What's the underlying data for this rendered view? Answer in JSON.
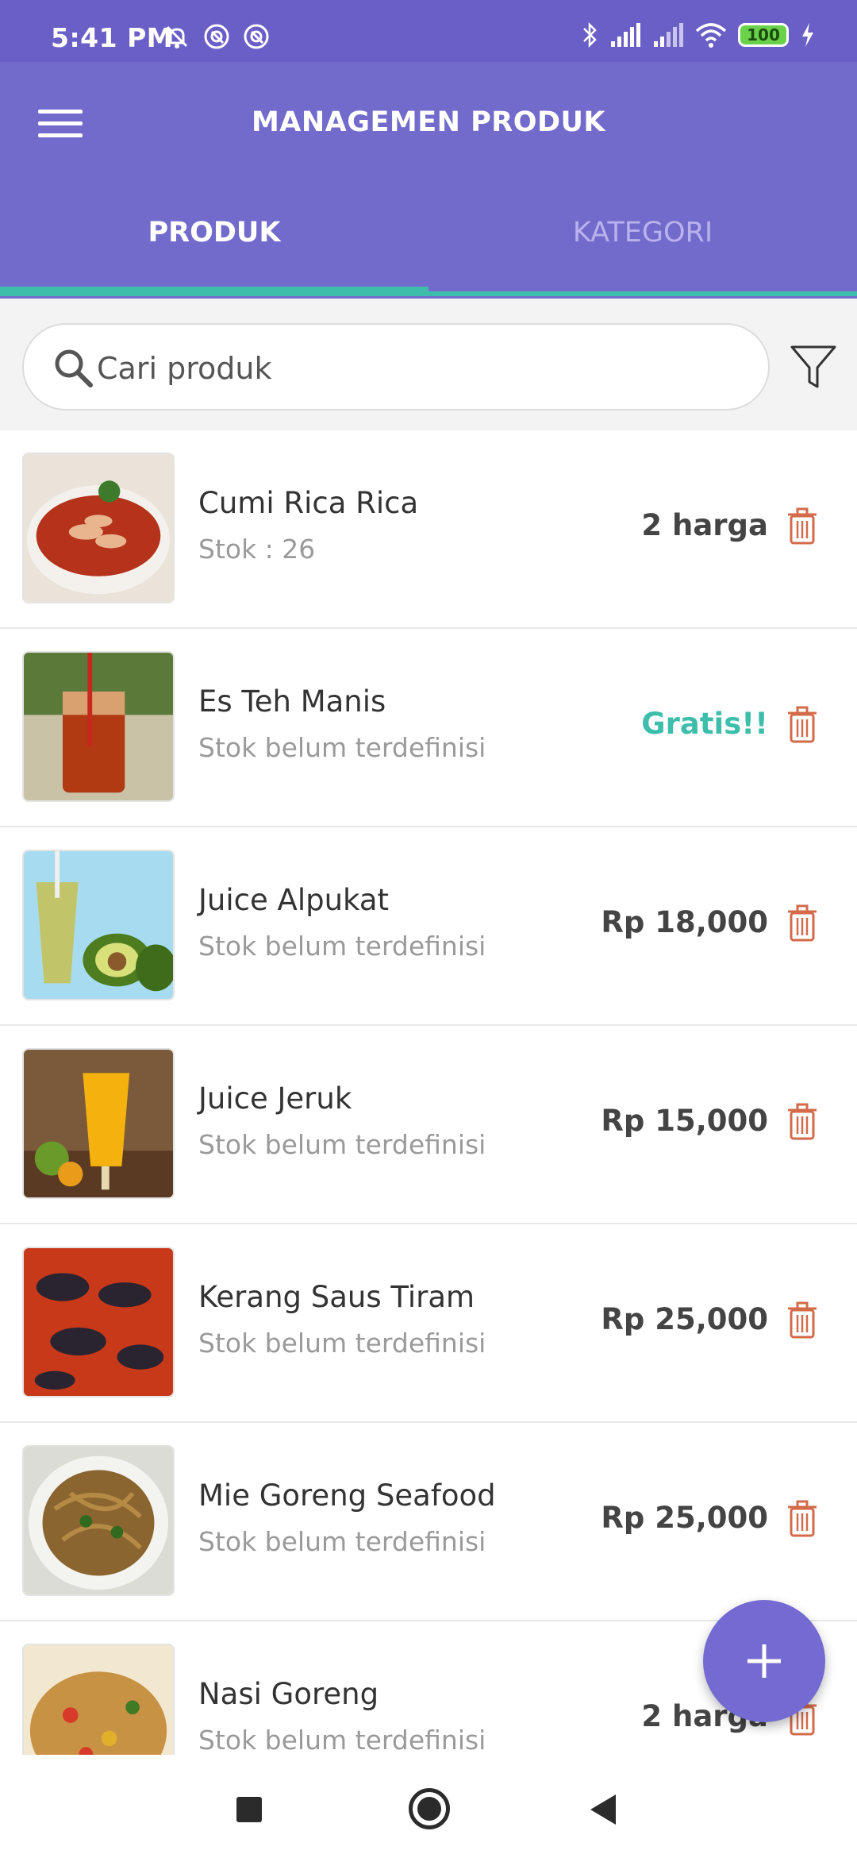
{
  "status_bar": {
    "time": "5:41 PM",
    "battery": "100",
    "icons": [
      "notifications-off-icon",
      "at-sign-icon",
      "at-sign-icon",
      "bluetooth-icon",
      "signal-icon",
      "signal-icon",
      "wifi-icon",
      "battery-icon",
      "charging-icon"
    ]
  },
  "app_bar": {
    "title": "MANAGEMEN PRODUK",
    "menu_icon": "hamburger-menu-icon"
  },
  "tabs": [
    {
      "label": "PRODUK",
      "selected": true
    },
    {
      "label": "KATEGORI",
      "selected": false
    }
  ],
  "search": {
    "placeholder": "Cari produk",
    "value": ""
  },
  "products": [
    {
      "name": "Cumi Rica Rica",
      "stock": "Stok : 26",
      "price": "2 harga",
      "image": "squid-dish"
    },
    {
      "name": "Es Teh Manis",
      "stock": "Stok belum terdefinisi",
      "price": "Gratis!!",
      "image": "iced-tea"
    },
    {
      "name": "Juice Alpukat",
      "stock": "Stok belum terdefinisi",
      "price": "Rp 18,000",
      "image": "avocado-juice"
    },
    {
      "name": "Juice Jeruk",
      "stock": "Stok belum terdefinisi",
      "price": "Rp 15,000",
      "image": "orange-juice"
    },
    {
      "name": "Kerang Saus Tiram",
      "stock": "Stok belum terdefinisi",
      "price": "Rp 25,000",
      "image": "mussels"
    },
    {
      "name": "Mie Goreng Seafood",
      "stock": "Stok belum terdefinisi",
      "price": "Rp 25,000",
      "image": "fried-noodles"
    },
    {
      "name": "Nasi Goreng",
      "stock": "Stok belum terdefinisi",
      "price": "2 harga",
      "image": "fried-rice"
    }
  ],
  "colors": {
    "primary": "#726bcb",
    "status_bar": "#6a5fc7",
    "accent_teal": "#3dbeab",
    "trash": "#d36a4a",
    "fab": "#756ad1"
  }
}
